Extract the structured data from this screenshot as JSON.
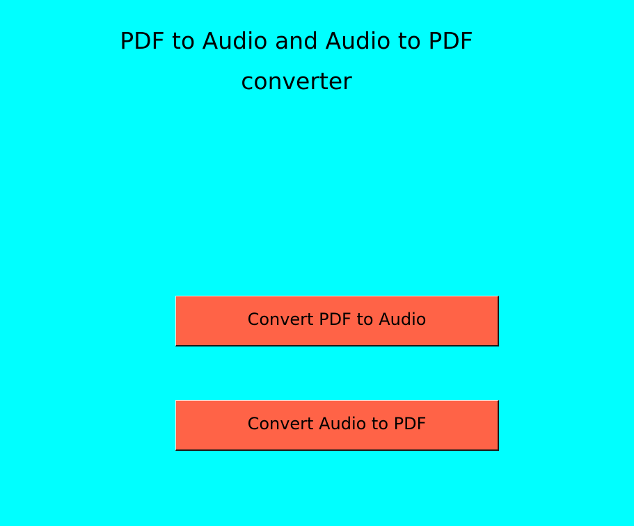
{
  "app": {
    "title_line1": "PDF to Audio and Audio to PDF",
    "title_line2": "converter"
  },
  "buttons": {
    "pdf_to_audio": "Convert PDF to Audio",
    "audio_to_pdf": "Convert Audio to PDF"
  },
  "colors": {
    "background": "#00FFFF",
    "button": "#FF6347",
    "text": "#000000"
  }
}
